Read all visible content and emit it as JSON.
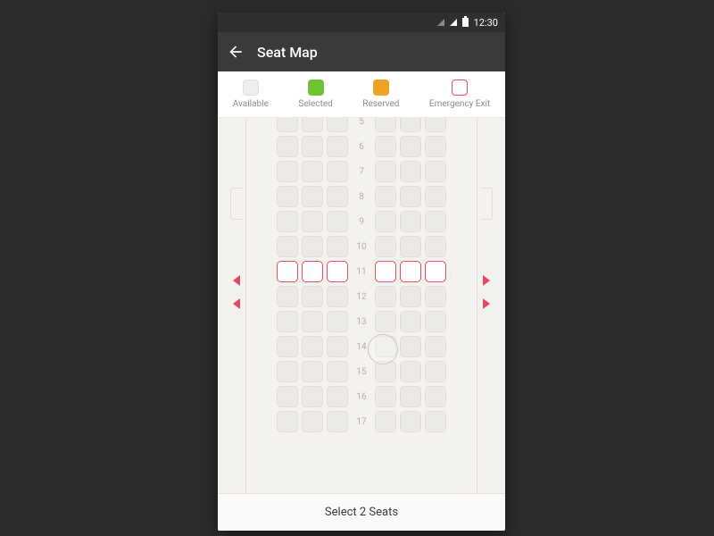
{
  "status": {
    "time": "12:30"
  },
  "appbar": {
    "title": "Seat Map"
  },
  "legend": {
    "available": "Available",
    "selected": "Selected",
    "reserved": "Reserved",
    "emergency": "Emergency Exit"
  },
  "rows": [
    {
      "n": "5",
      "emer": false
    },
    {
      "n": "6",
      "emer": false
    },
    {
      "n": "7",
      "emer": false
    },
    {
      "n": "8",
      "emer": false
    },
    {
      "n": "9",
      "emer": false
    },
    {
      "n": "10",
      "emer": false
    },
    {
      "n": "11",
      "emer": true
    },
    {
      "n": "12",
      "emer": false
    },
    {
      "n": "13",
      "emer": false
    },
    {
      "n": "14",
      "emer": false
    },
    {
      "n": "15",
      "emer": false
    },
    {
      "n": "16",
      "emer": false
    },
    {
      "n": "17",
      "emer": false
    }
  ],
  "footer": {
    "cta": "Select 2 Seats"
  }
}
